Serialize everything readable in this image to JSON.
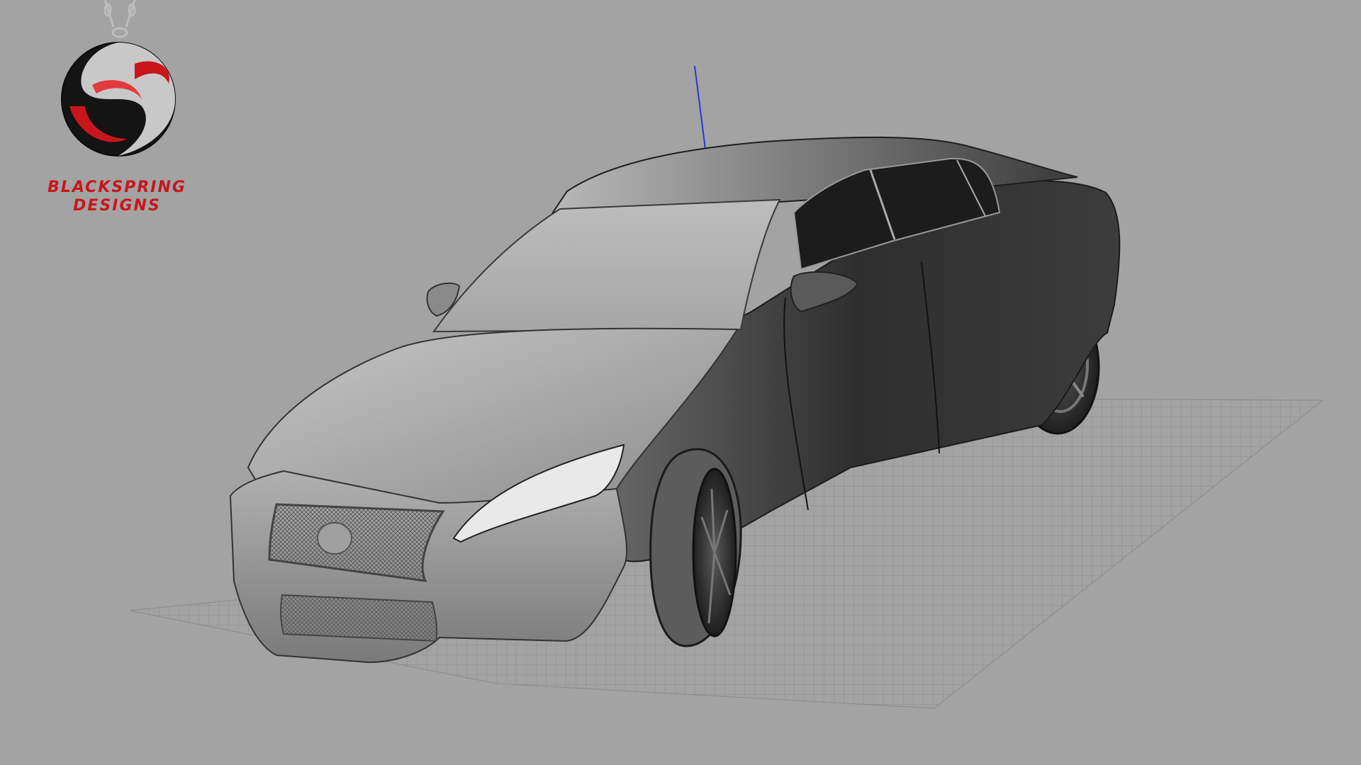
{
  "viewport": {
    "background": "#a3a3a3",
    "grid_color": "#8e8e8e",
    "axis_color": "#2a36d4"
  },
  "logo": {
    "name_line_1": "BLACKSPRING",
    "name_line_2": "DESIGNS",
    "brand_red": "#c9161c",
    "chain_icon": "chain-icon",
    "emblem_icon": "s-emblem-icon"
  },
  "model": {
    "subject": "car-wireframe-render-icon"
  }
}
